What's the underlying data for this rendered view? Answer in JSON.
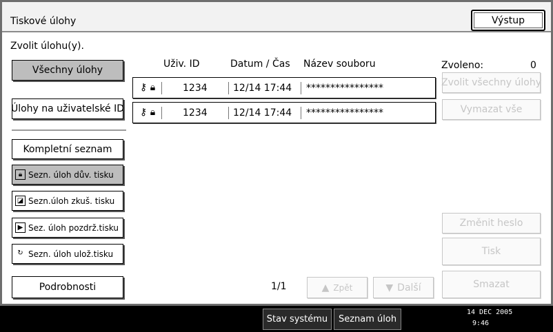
{
  "header": {
    "title": "Tiskové úlohy",
    "exit_label": "Výstup"
  },
  "prompt": "Zvolit úlohu(y).",
  "filter_buttons": {
    "all_jobs": "Všechny úlohy",
    "user_jobs": "Úlohy na uživatelské ID"
  },
  "list_buttons": {
    "complete": "Kompletní seznam",
    "locked": "Sezn. úloh dův. tisku",
    "sample": "Sezn.úloh zkuš. tisku",
    "hold": "Sez. úloh pozdrž.tisku",
    "stored": "Sezn. úloh ulož.tisku",
    "details": "Podrobnosti"
  },
  "columns": {
    "user_id": "Uživ. ID",
    "date_time": "Datum / Čas",
    "file_name": "Název souboru"
  },
  "rows": [
    {
      "user_id": "1234",
      "date_time": "12/14 17:44",
      "file_name": "****************"
    },
    {
      "user_id": "1234",
      "date_time": "12/14 17:44",
      "file_name": "****************"
    }
  ],
  "selection": {
    "label": "Zvoleno:",
    "count": "0"
  },
  "actions": {
    "select_all": "Zvolit všechny úlohy",
    "clear_all": "Vymazat vše",
    "change_password": "Změnit heslo",
    "print": "Tisk",
    "delete": "Smazat"
  },
  "pagination": {
    "page": "1/1",
    "prev": "Zpět",
    "next": "Další"
  },
  "taskbar": {
    "system_status": "Stav systému",
    "job_list": "Seznam úloh"
  },
  "clock": {
    "date": "14 DEC  2005",
    "time": "9:46"
  }
}
